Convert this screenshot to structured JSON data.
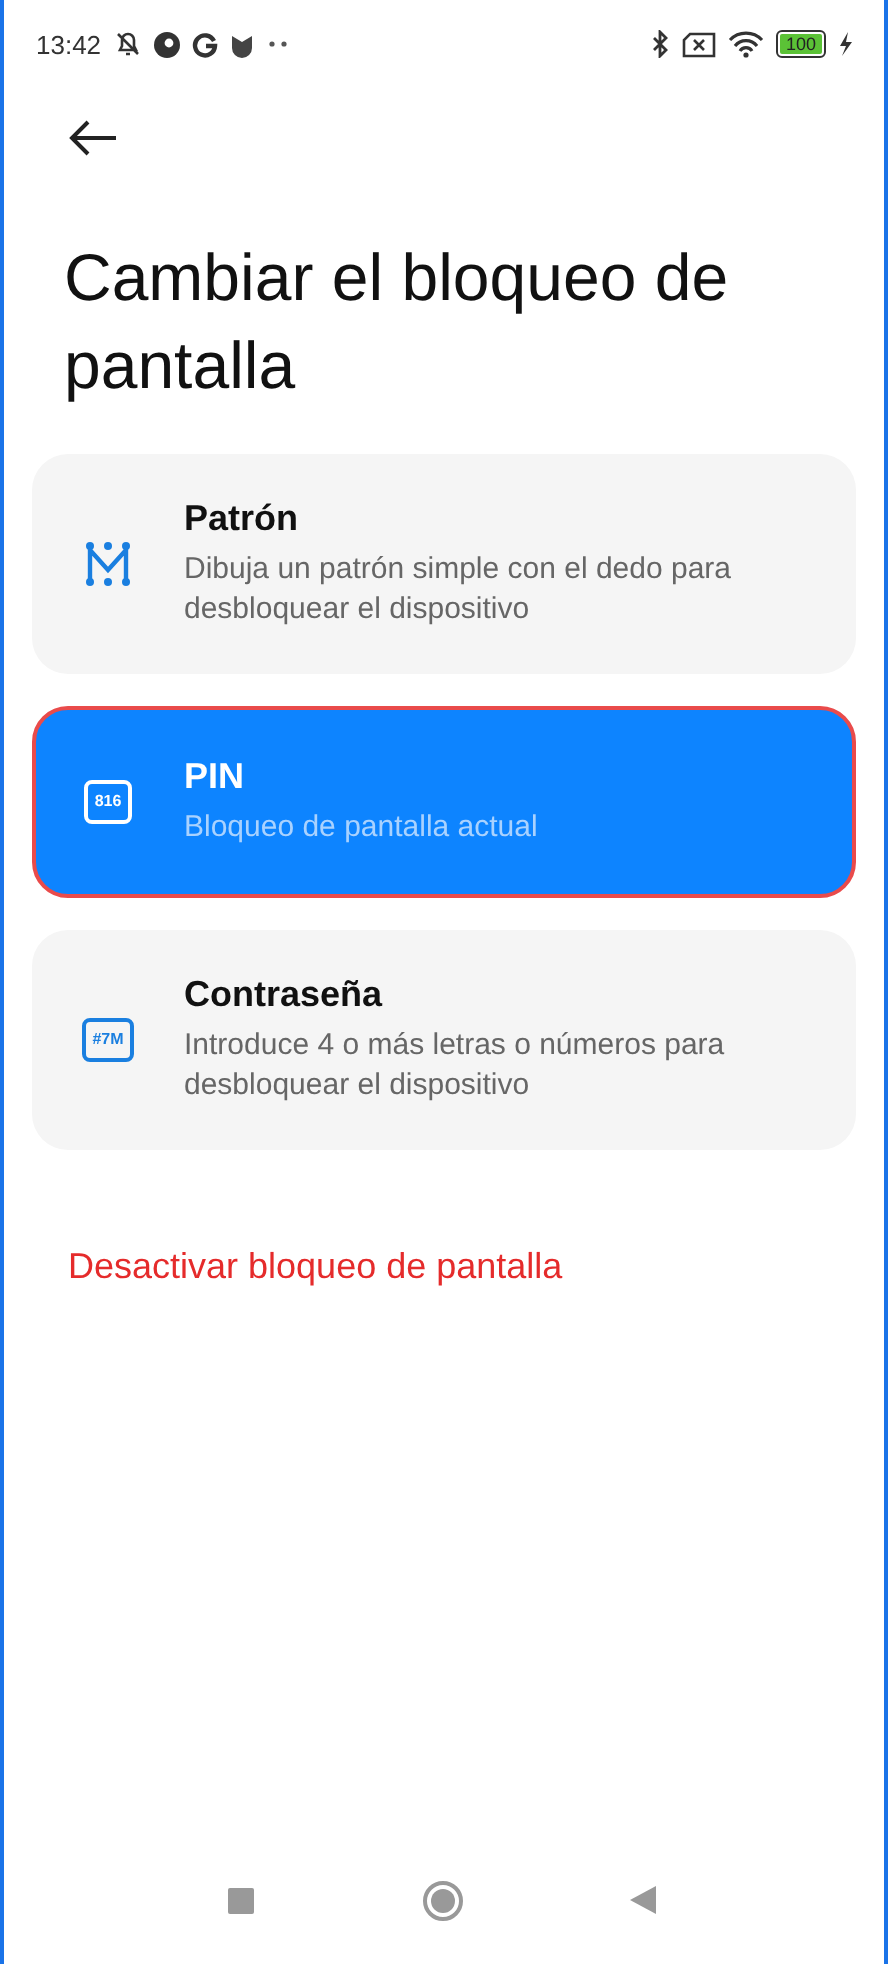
{
  "status_bar": {
    "time": "13:42",
    "battery": "100"
  },
  "title": "Cambiar el bloqueo de pantalla",
  "options": [
    {
      "kind": "pattern",
      "title": "Patrón",
      "description": "Dibuja un patrón simple con el dedo para desbloquear el dispositivo",
      "selected": false
    },
    {
      "kind": "pin",
      "icon_text": "816",
      "title": "PIN",
      "description": "Bloqueo de pantalla actual",
      "selected": true
    },
    {
      "kind": "password",
      "icon_text": "#7M",
      "title": "Contraseña",
      "description": "Introduce 4 o más letras o números para desbloquear el dispositivo",
      "selected": false
    }
  ],
  "disable_action": "Desactivar bloqueo de pantalla"
}
